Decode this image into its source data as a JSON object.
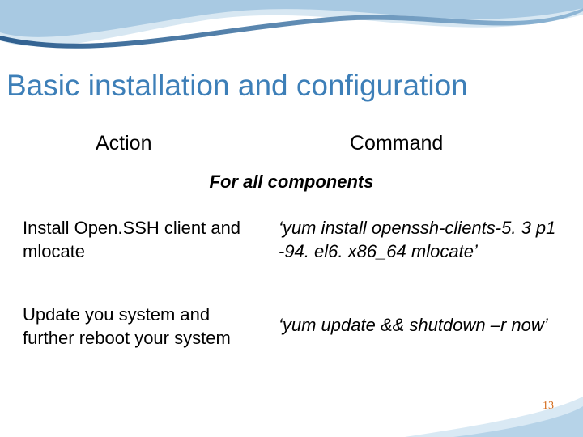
{
  "title": "Basic installation and configuration",
  "columns": {
    "action": "Action",
    "command": "Command"
  },
  "section": "For all components",
  "rows": [
    {
      "action": "Install Open.SSH client and mlocate",
      "command": "‘yum install openssh-clients-5. 3 p1 -94. el6. x86_64 mlocate’"
    },
    {
      "action": "Update you system and further reboot your system",
      "command": "‘yum update && shutdown –r now’"
    }
  ],
  "page_number": "13"
}
